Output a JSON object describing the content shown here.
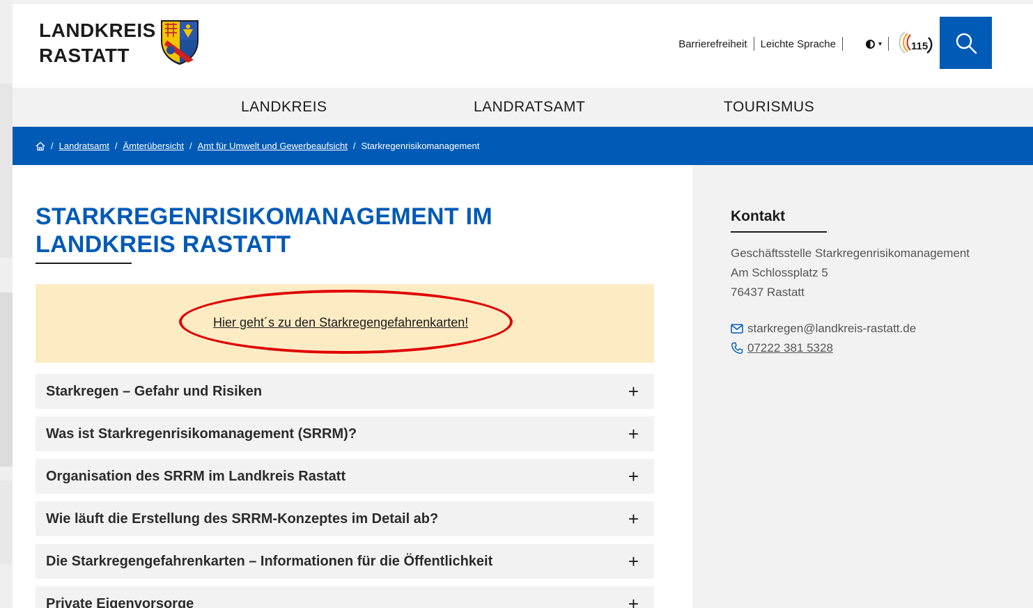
{
  "header": {
    "logo_line1": "LANDKREIS",
    "logo_line2": "RASTATT",
    "util_links": [
      "Barrierefreiheit",
      "Leichte Sprache"
    ],
    "badge_text": "115",
    "icons": {
      "contrast": "contrast-icon",
      "search": "search-icon",
      "badge": "115-service-icon"
    }
  },
  "mainnav": {
    "items": [
      "LANDKREIS",
      "LANDRATSAMT",
      "TOURISMUS"
    ]
  },
  "breadcrumb": {
    "home_icon": "home-icon",
    "items": [
      "Landratsamt",
      "Ämterübersicht",
      "Amt für Umwelt und Gewerbeaufsicht"
    ],
    "current": "Starkregenrisikomanagement",
    "separator": "/"
  },
  "main": {
    "title": "STARKREGENRISIKOMANAGEMENT IM LANDKREIS RASTATT",
    "notice_link": "Hier geht´s zu den Starkregengefahrenkarten!",
    "accordion": [
      "Starkregen – Gefahr und Risiken",
      "Was ist Starkregenrisikomanagement (SRRM)?",
      "Organisation des SRRM im Landkreis Rastatt",
      "Wie läuft die Erstellung des SRRM-Konzeptes im Detail ab?",
      "Die Starkregengefahrenkarten – Informationen für die Öffentlichkeit",
      "Private Eigenvorsorge"
    ],
    "accordion_toggle": "+"
  },
  "sidebar": {
    "title": "Kontakt",
    "address": [
      "Geschäftsstelle Starkregenrisikomanagement",
      "Am Schlossplatz 5",
      "76437 Rastatt"
    ],
    "email": "starkregen@landkreis-rastatt.de",
    "phone": "07222 381 5328"
  },
  "colors": {
    "brand_blue": "#005ab6",
    "notice_bg": "#fdebc4",
    "highlight_red": "#e00000",
    "panel_gray": "#f2f2f2"
  }
}
